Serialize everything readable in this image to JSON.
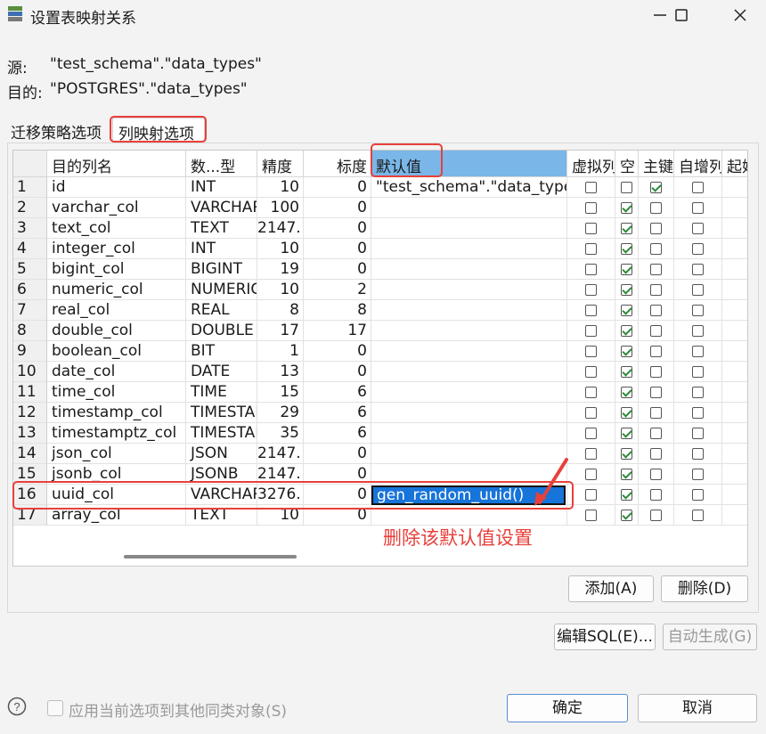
{
  "window": {
    "title": "设置表映射关系"
  },
  "source": {
    "label": "源:",
    "value": "\"test_schema\".\"data_types\""
  },
  "target": {
    "label": "目的:",
    "value": "\"POSTGRES\".\"data_types\""
  },
  "tabs": [
    {
      "label": "迁移策略选项"
    },
    {
      "label": "列映射选项",
      "active": true
    }
  ],
  "grid": {
    "headers": [
      "目的列名",
      "数...型",
      "精度",
      "标度",
      "默认值",
      "虚拟列",
      "空",
      "主键",
      "自增列",
      "起始"
    ],
    "selected_column": "默认值",
    "rows": [
      {
        "n": "1",
        "name": "id",
        "type": "INT",
        "precision": "10",
        "scale": "0",
        "default": "\"test_schema\".\"data_types\"",
        "virtual": false,
        "null": false,
        "pk": true,
        "auto": false
      },
      {
        "n": "2",
        "name": "varchar_col",
        "type": "VARCHAR",
        "precision": "100",
        "scale": "0",
        "default": "",
        "virtual": false,
        "null": true,
        "pk": false,
        "auto": false
      },
      {
        "n": "3",
        "name": "text_col",
        "type": "TEXT",
        "precision": "2147.",
        "scale": "0",
        "default": "",
        "virtual": false,
        "null": true,
        "pk": false,
        "auto": false
      },
      {
        "n": "4",
        "name": "integer_col",
        "type": "INT",
        "precision": "10",
        "scale": "0",
        "default": "",
        "virtual": false,
        "null": true,
        "pk": false,
        "auto": false
      },
      {
        "n": "5",
        "name": "bigint_col",
        "type": "BIGINT",
        "precision": "19",
        "scale": "0",
        "default": "",
        "virtual": false,
        "null": true,
        "pk": false,
        "auto": false
      },
      {
        "n": "6",
        "name": "numeric_col",
        "type": "NUMERIC",
        "precision": "10",
        "scale": "2",
        "default": "",
        "virtual": false,
        "null": true,
        "pk": false,
        "auto": false
      },
      {
        "n": "7",
        "name": "real_col",
        "type": "REAL",
        "precision": "8",
        "scale": "8",
        "default": "",
        "virtual": false,
        "null": true,
        "pk": false,
        "auto": false
      },
      {
        "n": "8",
        "name": "double_col",
        "type": "DOUBLE",
        "precision": "17",
        "scale": "17",
        "default": "",
        "virtual": false,
        "null": true,
        "pk": false,
        "auto": false
      },
      {
        "n": "9",
        "name": "boolean_col",
        "type": "BIT",
        "precision": "1",
        "scale": "0",
        "default": "",
        "virtual": false,
        "null": true,
        "pk": false,
        "auto": false
      },
      {
        "n": "10",
        "name": "date_col",
        "type": "DATE",
        "precision": "13",
        "scale": "0",
        "default": "",
        "virtual": false,
        "null": true,
        "pk": false,
        "auto": false
      },
      {
        "n": "11",
        "name": "time_col",
        "type": "TIME",
        "precision": "15",
        "scale": "6",
        "default": "",
        "virtual": false,
        "null": true,
        "pk": false,
        "auto": false
      },
      {
        "n": "12",
        "name": "timestamp_col",
        "type": "TIMESTAMP",
        "precision": "29",
        "scale": "6",
        "default": "",
        "virtual": false,
        "null": true,
        "pk": false,
        "auto": false
      },
      {
        "n": "13",
        "name": "timestamptz_col",
        "type": "TIMESTAMP",
        "precision": "35",
        "scale": "6",
        "default": "",
        "virtual": false,
        "null": true,
        "pk": false,
        "auto": false
      },
      {
        "n": "14",
        "name": "json_col",
        "type": "JSON",
        "precision": "2147.",
        "scale": "0",
        "default": "",
        "virtual": false,
        "null": true,
        "pk": false,
        "auto": false
      },
      {
        "n": "15",
        "name": "jsonb_col",
        "type": "JSONB",
        "precision": "2147.",
        "scale": "0",
        "default": "",
        "virtual": false,
        "null": true,
        "pk": false,
        "auto": false
      },
      {
        "n": "16",
        "name": "uuid_col",
        "type": "VARCHAR",
        "precision": "3276.",
        "scale": "0",
        "default": "gen_random_uuid()",
        "virtual": false,
        "null": true,
        "pk": false,
        "auto": false,
        "editing": true
      },
      {
        "n": "17",
        "name": "array_col",
        "type": "TEXT",
        "precision": "10",
        "scale": "0",
        "default": "",
        "virtual": false,
        "null": true,
        "pk": false,
        "auto": false
      }
    ]
  },
  "annotation": {
    "text": "删除该默认值设置",
    "color": "#e8403b"
  },
  "buttons": {
    "add": "添加(A)",
    "delete": "删除(D)",
    "edit_sql": "编辑SQL(E)...",
    "auto_generate": "自动生成(G)",
    "ok": "确定",
    "cancel": "取消"
  },
  "footer": {
    "apply_label": "应用当前选项到其他同类对象(S)"
  },
  "icons": {
    "help": "help-icon",
    "app": "app-icon",
    "minimize": "minimize-icon",
    "maximize": "maximize-icon",
    "close": "close-icon"
  }
}
